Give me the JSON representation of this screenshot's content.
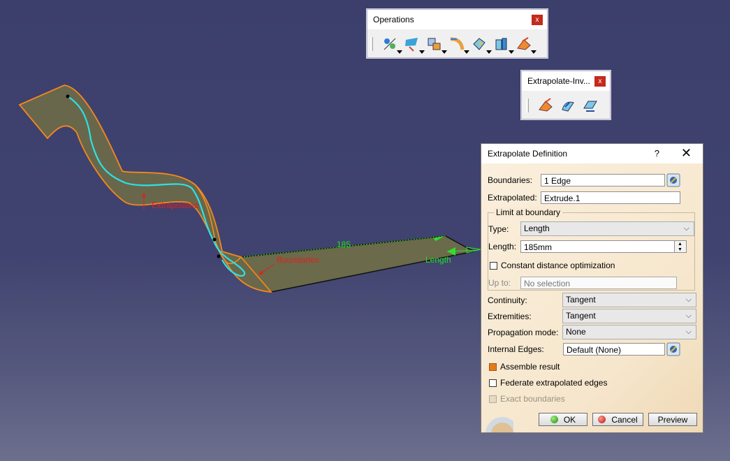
{
  "toolbars": {
    "operations": {
      "title": "Operations",
      "close": "x",
      "tools": [
        {
          "icon": "join-icon",
          "has_dropdown": true
        },
        {
          "icon": "split-icon",
          "has_dropdown": true
        },
        {
          "icon": "extract-icon",
          "has_dropdown": true
        },
        {
          "icon": "fillet-icon",
          "has_dropdown": true
        },
        {
          "icon": "translate-icon",
          "has_dropdown": true
        },
        {
          "icon": "extrapolate-icon",
          "has_dropdown": true
        },
        {
          "icon": "invert-icon",
          "has_dropdown": true
        }
      ]
    },
    "extrapolate_inv": {
      "title": "Extrapolate-Inv...",
      "close": "x",
      "tools": [
        {
          "icon": "extrapolate-icon"
        },
        {
          "icon": "invert-orientation-icon"
        },
        {
          "icon": "near-icon"
        }
      ]
    }
  },
  "viewport": {
    "labels": {
      "extrapolated": "Extrapolated",
      "boundaries": "Boundaries",
      "dimension": "185",
      "length": "Length"
    },
    "colors": {
      "surface": "#6b6a4a",
      "edge": "#ff8c1a",
      "boundary_curve": "#2de1e6",
      "annotation_red": "#e02020",
      "annotation_green": "#20e020"
    }
  },
  "dialog": {
    "title": "Extrapolate Definition",
    "help": "?",
    "close": "✕",
    "boundaries": {
      "label": "Boundaries:",
      "value": "1 Edge"
    },
    "extrapolated": {
      "label": "Extrapolated:",
      "value": "Extrude.1"
    },
    "limit_group": {
      "title": "Limit at boundary",
      "type": {
        "label": "Type:",
        "value": "Length"
      },
      "length": {
        "label": "Length:",
        "value": "185mm"
      },
      "constant_distance": {
        "label": "Constant distance optimization",
        "checked": false
      },
      "up_to": {
        "label": "Up to:",
        "value": "No selection"
      }
    },
    "continuity": {
      "label": "Continuity:",
      "value": "Tangent"
    },
    "extremities": {
      "label": "Extremities:",
      "value": "Tangent"
    },
    "propagation": {
      "label": "Propagation mode:",
      "value": "None"
    },
    "internal_edges": {
      "label": "Internal Edges:",
      "value": "Default (None)"
    },
    "assemble_result": {
      "label": "Assemble result",
      "checked": true
    },
    "federate": {
      "label": "Federate extrapolated edges",
      "checked": false
    },
    "exact_boundaries": {
      "label": "Exact boundaries",
      "checked": true,
      "disabled": true
    },
    "buttons": {
      "ok": "OK",
      "cancel": "Cancel",
      "preview": "Preview"
    }
  }
}
